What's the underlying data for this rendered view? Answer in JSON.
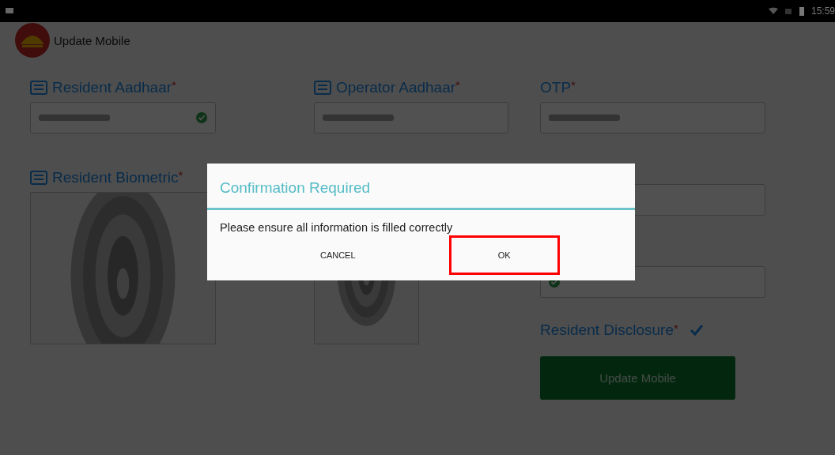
{
  "status_bar": {
    "time": "15:59"
  },
  "app_bar": {
    "title": "Update Mobile"
  },
  "columns": [
    {
      "fields": [
        {
          "kind": "input",
          "label": "Resident Aadhaar",
          "required_mark": "*",
          "icon": true,
          "masked": true,
          "verified": true
        },
        {
          "kind": "picture",
          "label": "Resident Biometric",
          "required_mark": "*",
          "icon": true
        }
      ]
    },
    {
      "fields": [
        {
          "kind": "input",
          "label": "Operator Aadhaar",
          "required_mark": "*",
          "icon": true,
          "masked": true,
          "verified": false
        },
        {
          "kind": "picture"
        }
      ]
    },
    {
      "fields": [
        {
          "kind": "input",
          "label": "OTP",
          "required_mark": "*",
          "icon": false,
          "masked": true,
          "verified": false
        },
        {
          "kind": "input",
          "masked": false,
          "verified": false
        },
        {
          "kind": "input",
          "masked": false,
          "verified": true
        },
        {
          "kind": "checkbox",
          "label": "Resident Disclosure",
          "required_mark": "*",
          "checked": true
        },
        {
          "kind": "button",
          "label": "Update Mobile"
        }
      ]
    }
  ],
  "dialog": {
    "title": "Confirmation Required",
    "message": "Please ensure all information is filled correctly",
    "buttons": [
      {
        "label": "CANCEL",
        "highlighted": false
      },
      {
        "label": "OK",
        "highlighted": true
      }
    ]
  }
}
